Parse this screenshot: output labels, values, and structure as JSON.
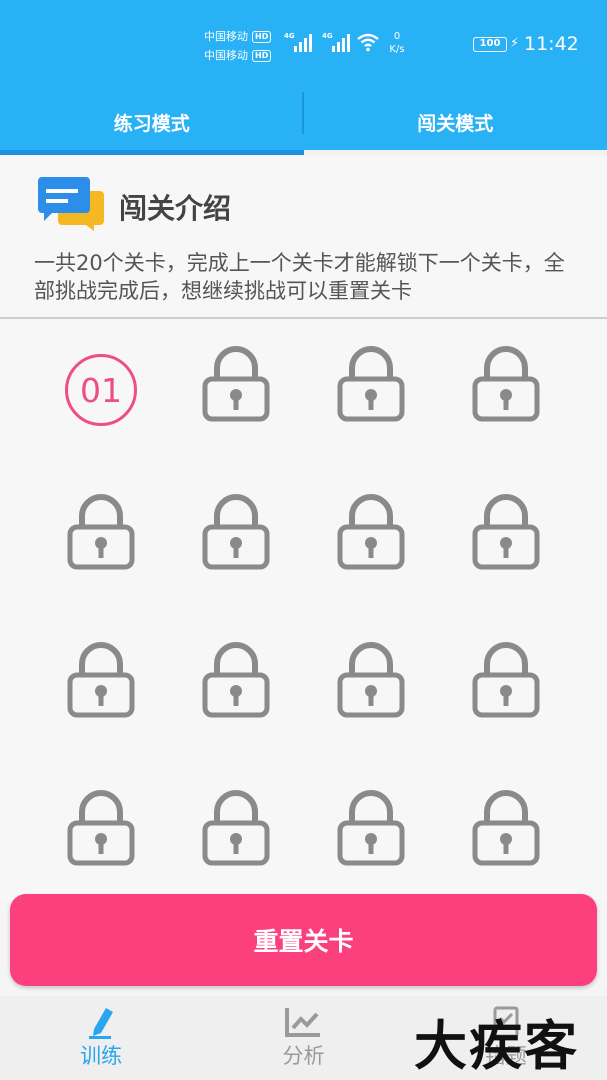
{
  "status_bar": {
    "carrier_1": "中国移动",
    "carrier_2": "中国移动",
    "hd_badge": "HD",
    "network_1": "4G",
    "network_2": "4G",
    "speed_value": "0",
    "speed_unit": "K/s",
    "battery": "100",
    "time": "11:42",
    "icons": [
      "signal-icon",
      "wifi-icon",
      "battery-icon",
      "charging-icon"
    ]
  },
  "tabs": [
    {
      "label": "练习模式",
      "active": false
    },
    {
      "label": "闯关模式",
      "active": true
    }
  ],
  "intro": {
    "title": "闯关介绍",
    "description": "一共20个关卡，完成上一个关卡才能解锁下一个关卡，全部挑战完成后，想继续挑战可以重置关卡",
    "icon": "chat-bubbles-icon"
  },
  "levels": {
    "current_label": "01",
    "locked_icon": "lock-icon"
  },
  "reset_button": {
    "label": "重置关卡"
  },
  "bottom_nav": [
    {
      "label": "训练",
      "icon": "pencil-icon",
      "active": true
    },
    {
      "label": "分析",
      "icon": "chart-icon",
      "active": false
    },
    {
      "label": "错题",
      "icon": "notebook-icon",
      "active": false
    }
  ],
  "watermark": "大疾客",
  "colors": {
    "primary_blue": "#29b1f5",
    "accent_pink": "#fc3f7d",
    "current_level_pink": "#ee4e88",
    "lock_gray": "#8a8a8a"
  }
}
